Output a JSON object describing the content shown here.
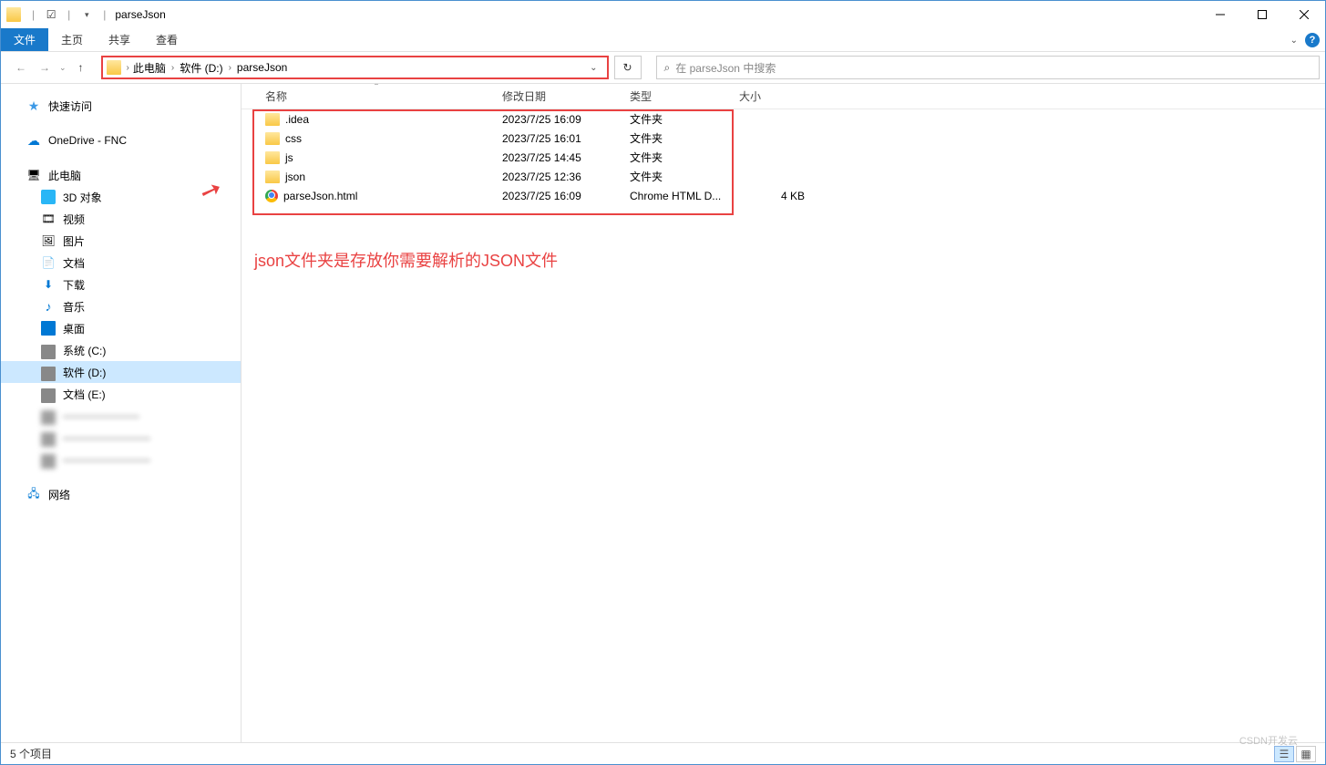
{
  "title": "parseJson",
  "tabs": {
    "file": "文件",
    "home": "主页",
    "share": "共享",
    "view": "查看"
  },
  "breadcrumb": {
    "items": [
      "此电脑",
      "软件 (D:)",
      "parseJson"
    ]
  },
  "search": {
    "placeholder": "在 parseJson 中搜索"
  },
  "columns": {
    "name": "名称",
    "date": "修改日期",
    "type": "类型",
    "size": "大小"
  },
  "sidebar": {
    "quickAccess": "快速访问",
    "onedrive": "OneDrive - FNC",
    "thisPC": "此电脑",
    "threeD": "3D 对象",
    "videos": "视频",
    "pictures": "图片",
    "documents": "文档",
    "downloads": "下载",
    "music": "音乐",
    "desktop": "桌面",
    "driveC": "系统 (C:)",
    "driveD": "软件 (D:)",
    "driveE": "文档 (E:)",
    "network": "网络"
  },
  "files": [
    {
      "name": ".idea",
      "date": "2023/7/25 16:09",
      "type": "文件夹",
      "size": "",
      "icon": "folder"
    },
    {
      "name": "css",
      "date": "2023/7/25 16:01",
      "type": "文件夹",
      "size": "",
      "icon": "folder"
    },
    {
      "name": "js",
      "date": "2023/7/25 14:45",
      "type": "文件夹",
      "size": "",
      "icon": "folder"
    },
    {
      "name": "json",
      "date": "2023/7/25 12:36",
      "type": "文件夹",
      "size": "",
      "icon": "folder"
    },
    {
      "name": "parseJson.html",
      "date": "2023/7/25 16:09",
      "type": "Chrome HTML D...",
      "size": "4 KB",
      "icon": "chrome"
    }
  ],
  "annotation": "json文件夹是存放你需要解析的JSON文件",
  "status": "5 个项目",
  "watermark": "CSDN开发云"
}
